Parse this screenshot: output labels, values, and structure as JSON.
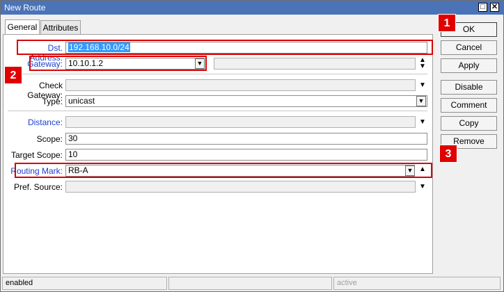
{
  "window": {
    "title": "New Route",
    "restore_glyph": "□",
    "close_glyph": "✕"
  },
  "tabs": [
    {
      "label": "General"
    },
    {
      "label": "Attributes"
    }
  ],
  "form": {
    "dst_address": {
      "label": "Dst. Address:",
      "value": "192.168.10.0/24"
    },
    "gateway": {
      "label": "Gateway:",
      "value": "10.10.1.2"
    },
    "check_gateway": {
      "label": "Check Gateway:",
      "value": ""
    },
    "type": {
      "label": "Type:",
      "value": "unicast"
    },
    "distance": {
      "label": "Distance:",
      "value": ""
    },
    "scope": {
      "label": "Scope:",
      "value": "30"
    },
    "target_scope": {
      "label": "Target Scope:",
      "value": "10"
    },
    "routing_mark": {
      "label": "Routing Mark:",
      "value": "RB-A"
    },
    "pref_source": {
      "label": "Pref. Source:",
      "value": ""
    }
  },
  "buttons": {
    "ok": "OK",
    "cancel": "Cancel",
    "apply": "Apply",
    "disable": "Disable",
    "comment": "Comment",
    "copy": "Copy",
    "remove": "Remove"
  },
  "annotations": {
    "badge1": "1",
    "badge2": "2",
    "badge3": "3"
  },
  "status": {
    "state": "enabled",
    "middle": "",
    "right": "active"
  },
  "colors": {
    "titlebar": "#4a73b8",
    "label_blue": "#1a3fd0",
    "highlight_red": "#d80000",
    "selection": "#3399ff"
  },
  "icons": {
    "dropdown": "down-triangle",
    "updown": "up-down-triangles",
    "combo": "combo-arrow"
  }
}
